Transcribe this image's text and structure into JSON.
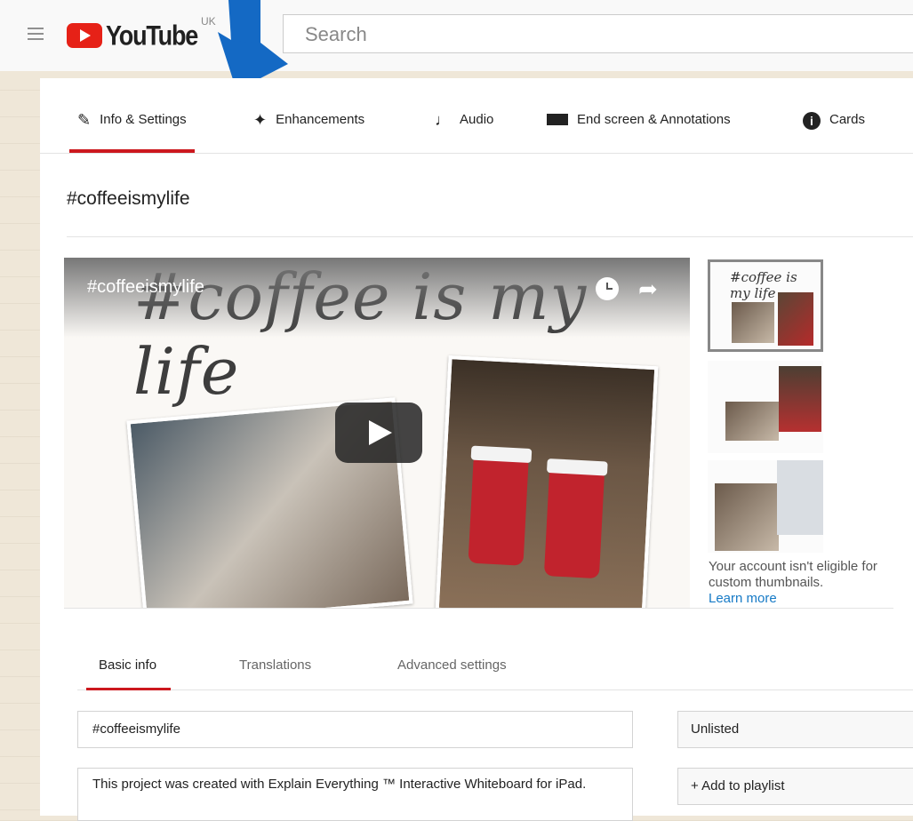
{
  "header": {
    "logo_text": "YouTube",
    "region": "UK",
    "search_placeholder": "Search"
  },
  "tabs": [
    {
      "label": "Info & Settings",
      "icon": "pencil-icon",
      "active": true
    },
    {
      "label": "Enhancements",
      "icon": "magic-wand-icon",
      "active": false
    },
    {
      "label": "Audio",
      "icon": "music-note-icon",
      "active": false
    },
    {
      "label": "End screen & Annotations",
      "icon": "end-screen-icon",
      "active": false
    },
    {
      "label": "Cards",
      "icon": "info-icon",
      "active": false
    }
  ],
  "video": {
    "page_title": "#coffeeismylife",
    "player_title": "#coffeeismylife",
    "script_text": "#coffee is my life",
    "thumb_text": "#coffee is my life"
  },
  "thumbnail_notice": {
    "text": "Your account isn't eligible for custom thumbnails.",
    "link": "Learn more"
  },
  "subtabs": [
    {
      "label": "Basic info",
      "active": true
    },
    {
      "label": "Translations",
      "active": false
    },
    {
      "label": "Advanced settings",
      "active": false
    }
  ],
  "form": {
    "title_value": "#coffeeismylife",
    "description_value": "This project was created with Explain Everything ™ Interactive Whiteboard for iPad.",
    "privacy_value": "Unlisted",
    "playlist_label": "+ Add to playlist"
  },
  "colors": {
    "accent": "#cc181e",
    "arrow": "#1469c4",
    "link": "#167ac6"
  }
}
